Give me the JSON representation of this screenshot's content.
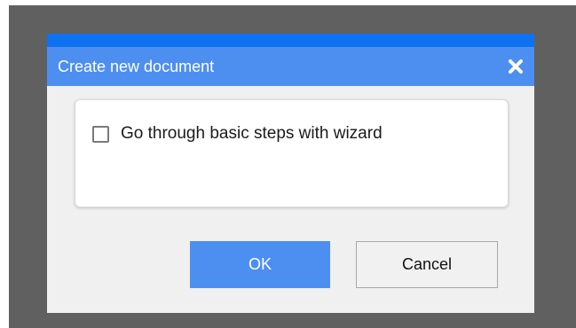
{
  "dialog": {
    "title": "Create new document",
    "close_icon": "close-x-icon",
    "wizard_checkbox": {
      "label": "Go through basic steps with wizard",
      "checked": false
    },
    "buttons": {
      "ok_label": "OK",
      "cancel_label": "Cancel"
    }
  },
  "colors": {
    "backdrop": "#606060",
    "title_strip": "#0d72f2",
    "title_bar": "#4d8ff0",
    "dialog_bg": "#f0f0f0",
    "primary_button": "#4d8ff0"
  }
}
